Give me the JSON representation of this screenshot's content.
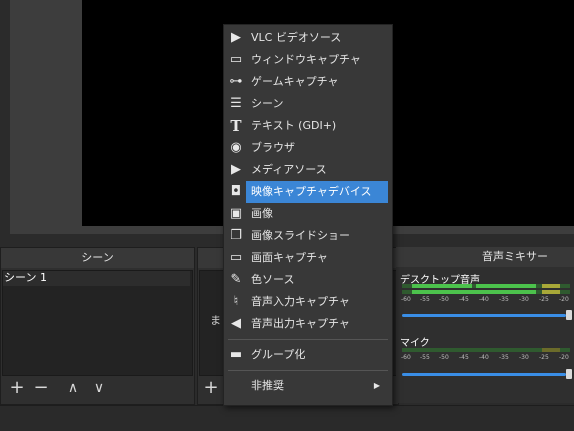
{
  "docks": {
    "scenes_title": "シーン",
    "scene_items": [
      "シーン 1"
    ],
    "sources_partial_text": "ま",
    "mixer_title": "音声ミキサー",
    "mixer_channels": [
      {
        "name": "デスクトップ音声",
        "level_fraction": 0.0,
        "volume_fraction": 1.0
      },
      {
        "name": "マイク",
        "level_fraction": 0.0,
        "volume_fraction": 1.0
      }
    ],
    "meter_ticks": [
      "-60",
      "-55",
      "-50",
      "-45",
      "-40",
      "-35",
      "-30",
      "-25",
      "-20"
    ]
  },
  "toolbar_icons": {
    "add": "+",
    "remove": "−",
    "up": "∧",
    "down": "∨"
  },
  "menu": {
    "items": [
      {
        "label": "VLC ビデオソース",
        "icon": "play-icon",
        "glyph": "▶"
      },
      {
        "label": "ウィンドウキャプチャ",
        "icon": "window-icon",
        "glyph": "▭"
      },
      {
        "label": "ゲームキャプチャ",
        "icon": "gamepad-icon",
        "glyph": "⊶"
      },
      {
        "label": "シーン",
        "icon": "list-icon",
        "glyph": "☰"
      },
      {
        "label": "テキスト (GDI+)",
        "icon": "text-icon",
        "glyph": "T"
      },
      {
        "label": "ブラウザ",
        "icon": "globe-icon",
        "glyph": "◉"
      },
      {
        "label": "メディアソース",
        "icon": "play-icon",
        "glyph": "▶"
      },
      {
        "label": "映像キャプチャデバイス",
        "icon": "camera-icon",
        "glyph": "◘"
      },
      {
        "label": "画像",
        "icon": "image-icon",
        "glyph": "▣"
      },
      {
        "label": "画像スライドショー",
        "icon": "slideshow-icon",
        "glyph": "❐"
      },
      {
        "label": "画面キャプチャ",
        "icon": "monitor-icon",
        "glyph": "▭"
      },
      {
        "label": "色ソース",
        "icon": "brush-icon",
        "glyph": "✎"
      },
      {
        "label": "音声入力キャプチャ",
        "icon": "microphone-icon",
        "glyph": "♮"
      },
      {
        "label": "音声出力キャプチャ",
        "icon": "speaker-icon",
        "glyph": "◀"
      }
    ],
    "group_label": "グループ化",
    "group_glyph": "▬",
    "deprecated_label": "非推奨",
    "submenu_arrow": "▶",
    "selected_index": 7
  },
  "colors": {
    "highlight": "#3b86d6",
    "meter_green": "#4cc24c",
    "meter_yellow": "#c8c83a",
    "slider_blue": "#3a8ee6"
  }
}
